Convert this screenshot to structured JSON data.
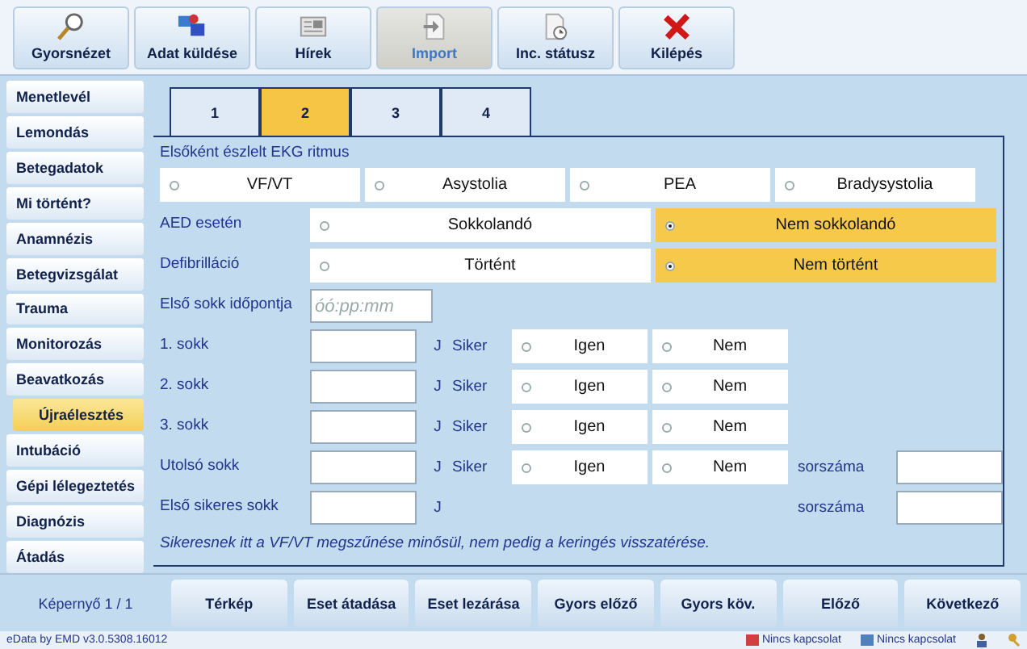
{
  "toolbar": [
    {
      "label": "Gyorsnézet",
      "kind": "search",
      "selected": false
    },
    {
      "label": "Adat küldése",
      "kind": "send",
      "selected": false
    },
    {
      "label": "Hírek",
      "kind": "news",
      "selected": false
    },
    {
      "label": "Import",
      "kind": "import",
      "selected": true
    },
    {
      "label": "Inc. státusz",
      "kind": "status",
      "selected": false
    },
    {
      "label": "Kilépés",
      "kind": "exit",
      "selected": false
    }
  ],
  "sidebar": {
    "items": [
      {
        "label": "Menetlevél",
        "selected": false
      },
      {
        "label": "Lemondás",
        "selected": false
      },
      {
        "label": "Betegadatok",
        "selected": false
      },
      {
        "label": "Mi történt?",
        "selected": false
      },
      {
        "label": "Anamnézis",
        "selected": false
      },
      {
        "label": "Betegvizsgálat",
        "selected": false
      },
      {
        "label": "Trauma",
        "selected": false
      },
      {
        "label": "Monitorozás",
        "selected": false
      },
      {
        "label": "Beavatkozás",
        "selected": false,
        "children": [
          {
            "label": "Újraélesztés",
            "selected": true
          }
        ]
      },
      {
        "label": "Intubáció",
        "selected": false
      },
      {
        "label": "Gépi lélegeztetés",
        "selected": false
      },
      {
        "label": "Diagnózis",
        "selected": false
      },
      {
        "label": "Átadás",
        "selected": false
      }
    ]
  },
  "tabs": [
    {
      "label": "1",
      "selected": false
    },
    {
      "label": "2",
      "selected": true
    },
    {
      "label": "3",
      "selected": false
    },
    {
      "label": "4",
      "selected": false
    }
  ],
  "form": {
    "ekg": {
      "label": "Elsőként észlelt EKG ritmus",
      "options": [
        {
          "label": "VF/VT",
          "selected": false
        },
        {
          "label": "Asystolia",
          "selected": false
        },
        {
          "label": "PEA",
          "selected": false
        },
        {
          "label": "Bradysystolia",
          "selected": false
        }
      ]
    },
    "aed": {
      "label": "AED esetén",
      "options": [
        {
          "label": "Sokkolandó",
          "selected": false
        },
        {
          "label": "Nem sokkolandó",
          "selected": true
        }
      ]
    },
    "defib": {
      "label": "Defibrilláció",
      "options": [
        {
          "label": "Történt",
          "selected": false
        },
        {
          "label": "Nem történt",
          "selected": true
        }
      ]
    },
    "first_shock_time": {
      "label": "Első sokk időpontja",
      "placeholder": "óó:pp:mm"
    },
    "shocks": [
      {
        "label": "1. sokk",
        "unit": "J",
        "success_label": "Siker",
        "options": [
          {
            "label": "Igen",
            "selected": false
          },
          {
            "label": "Nem",
            "selected": false
          }
        ]
      },
      {
        "label": "2. sokk",
        "unit": "J",
        "success_label": "Siker",
        "options": [
          {
            "label": "Igen",
            "selected": false
          },
          {
            "label": "Nem",
            "selected": false
          }
        ]
      },
      {
        "label": "3. sokk",
        "unit": "J",
        "success_label": "Siker",
        "options": [
          {
            "label": "Igen",
            "selected": false
          },
          {
            "label": "Nem",
            "selected": false
          }
        ]
      },
      {
        "label": "Utolsó sokk",
        "unit": "J",
        "success_label": "Siker",
        "options": [
          {
            "label": "Igen",
            "selected": false
          },
          {
            "label": "Nem",
            "selected": false
          }
        ],
        "number_label": "sorszáma"
      },
      {
        "label": "Első sikeres sokk",
        "unit": "J",
        "number_label": "sorszáma"
      }
    ],
    "note": "Sikeresnek itt a VF/VT megszűnése minősül, nem pedig a keringés visszatérése."
  },
  "bottom": {
    "page_label": "Képernyő 1 / 1",
    "buttons": [
      "Térkép",
      "Eset átadása",
      "Eset lezárása",
      "Gyors előző",
      "Gyors köv.",
      "Előző",
      "Következő"
    ]
  },
  "status_bar": {
    "version": "eData by EMD v3.0.5308.16012",
    "connections": [
      "Nincs kapcsolat",
      "Nincs kapcsolat"
    ]
  }
}
